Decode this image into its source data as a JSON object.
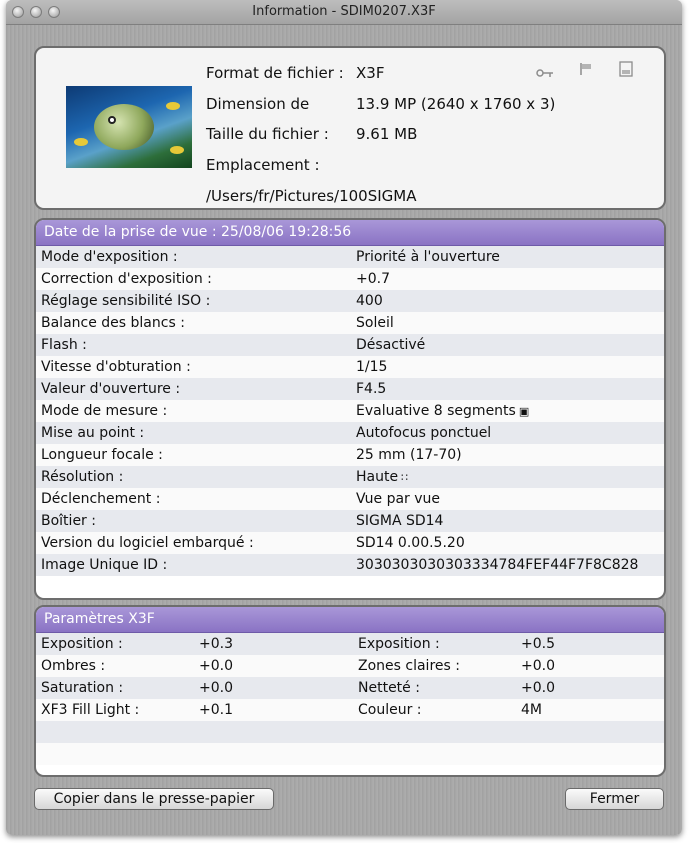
{
  "window": {
    "title": "Information - SDIM0207.X3F"
  },
  "file_info": {
    "format_label": "Format de fichier :",
    "format_value": "X3F",
    "dimension_label": "Dimension de",
    "dimension_value": "13.9 MP (2640 x 1760 x 3)",
    "size_label": "Taille du fichier :",
    "size_value": "9.61 MB",
    "location_label": "Emplacement :",
    "location_value": "/Users/fr/Pictures/100SIGMA",
    "icons": [
      "key-icon",
      "flag-icon",
      "disk-icon"
    ]
  },
  "exif": {
    "header": "Date de la prise de vue : 25/08/06 19:28:56",
    "rows": [
      {
        "label": "Mode d'exposition :",
        "value": "Priorité à l'ouverture"
      },
      {
        "label": "Correction d'exposition :",
        "value": "+0.7"
      },
      {
        "label": "Réglage sensibilité ISO :",
        "value": "400"
      },
      {
        "label": "Balance des blancs :",
        "value": "Soleil"
      },
      {
        "label": "Flash :",
        "value": "Désactivé"
      },
      {
        "label": "Vitesse d'obturation :",
        "value": "1/15"
      },
      {
        "label": "Valeur d'ouverture :",
        "value": "F4.5"
      },
      {
        "label": "Mode de mesure :",
        "value": "Evaluative 8 segments",
        "icon": "metering-icon"
      },
      {
        "label": "Mise au point :",
        "value": "Autofocus ponctuel"
      },
      {
        "label": "Longueur focale :",
        "value": "25 mm (17-70)"
      },
      {
        "label": "Résolution :",
        "value": "Haute",
        "icon": "resolution-icon"
      },
      {
        "label": "Déclenchement :",
        "value": "Vue par vue"
      },
      {
        "label": "Boîtier :",
        "value": "SIGMA SD14"
      },
      {
        "label": "Version du logiciel embarqué :",
        "value": "SD14 0.00.5.20"
      },
      {
        "label": "Image Unique ID :",
        "value": "3030303030303334784FEF44F7F8C828"
      }
    ]
  },
  "x3f": {
    "header": "Paramètres X3F",
    "rows": [
      {
        "l1": "Exposition :",
        "v1": "+0.3",
        "l2": "Exposition :",
        "v2": "+0.5"
      },
      {
        "l1": "Ombres :",
        "v1": "+0.0",
        "l2": "Zones claires :",
        "v2": "+0.0"
      },
      {
        "l1": "Saturation :",
        "v1": "+0.0",
        "l2": "Netteté :",
        "v2": "+0.0"
      },
      {
        "l1": "XF3 Fill Light :",
        "v1": "+0.1",
        "l2": "Couleur :",
        "v2": "4M"
      }
    ]
  },
  "buttons": {
    "copy": "Copier dans le presse-papier",
    "close": "Fermer"
  }
}
